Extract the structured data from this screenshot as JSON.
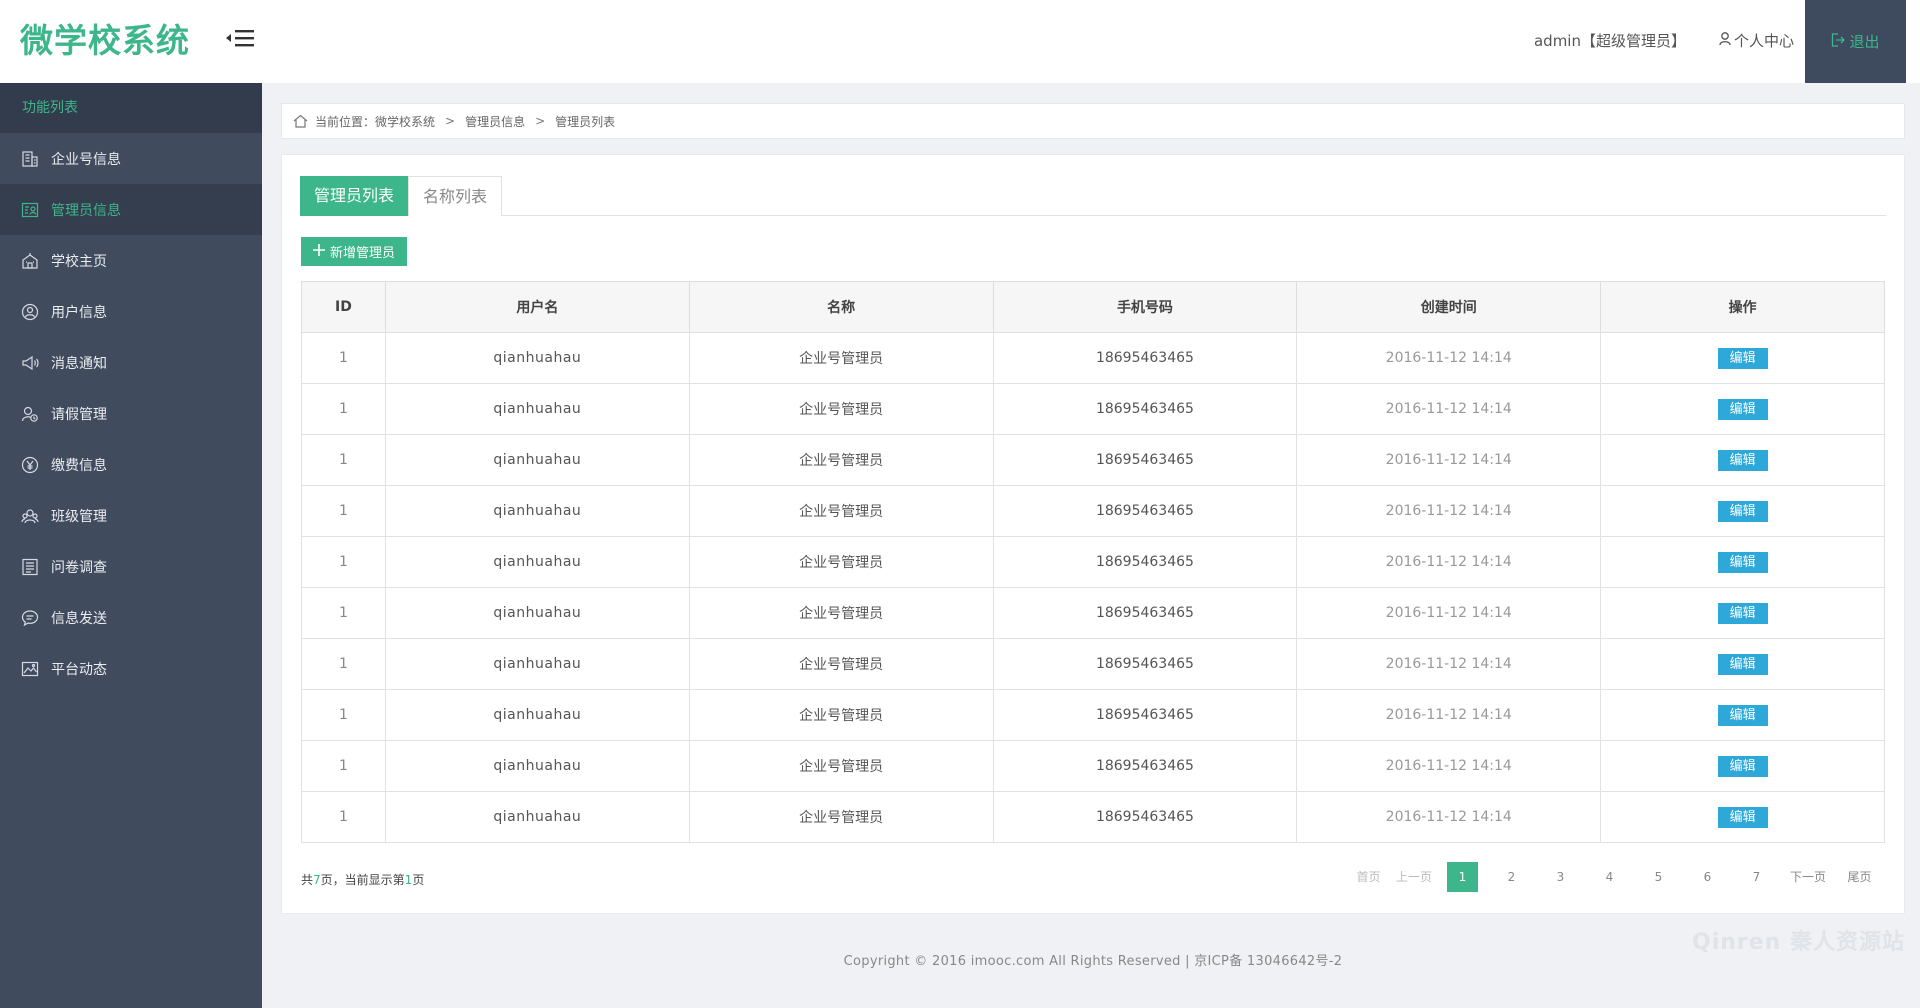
{
  "app": {
    "logo": "微学校系统"
  },
  "header": {
    "user_label": "admin【超级管理员】",
    "profile_label": "个人中心",
    "logout_label": "退出"
  },
  "sidebar": {
    "title": "功能列表",
    "items": [
      {
        "label": "企业号信息",
        "icon": "building-icon"
      },
      {
        "label": "管理员信息",
        "icon": "admin-card-icon",
        "active": true
      },
      {
        "label": "学校主页",
        "icon": "school-icon"
      },
      {
        "label": "用户信息",
        "icon": "user-circle-icon"
      },
      {
        "label": "消息通知",
        "icon": "megaphone-icon"
      },
      {
        "label": "请假管理",
        "icon": "leave-request-icon"
      },
      {
        "label": "缴费信息",
        "icon": "yen-coin-icon"
      },
      {
        "label": "班级管理",
        "icon": "class-group-icon"
      },
      {
        "label": "问卷调查",
        "icon": "survey-list-icon"
      },
      {
        "label": "信息发送",
        "icon": "chat-bubble-icon"
      },
      {
        "label": "平台动态",
        "icon": "picture-trend-icon"
      }
    ]
  },
  "breadcrumb": {
    "prefix": "当前位置：微学校系统",
    "level2": "管理员信息",
    "level3": "管理员列表",
    "separator": ">"
  },
  "tabs": [
    {
      "label": "管理员列表",
      "active": true
    },
    {
      "label": "名称列表",
      "active": false
    }
  ],
  "add_button": {
    "label": "新增管理员"
  },
  "table": {
    "headers": [
      "ID",
      "用户名",
      "名称",
      "手机号码",
      "创建时间",
      "操作"
    ],
    "rows": [
      {
        "id": "1",
        "username": "qianhuahau",
        "name": "企业号管理员",
        "phone": "18695463465",
        "created": "2016-11-12  14:14",
        "action": "编辑"
      },
      {
        "id": "1",
        "username": "qianhuahau",
        "name": "企业号管理员",
        "phone": "18695463465",
        "created": "2016-11-12  14:14",
        "action": "编辑"
      },
      {
        "id": "1",
        "username": "qianhuahau",
        "name": "企业号管理员",
        "phone": "18695463465",
        "created": "2016-11-12  14:14",
        "action": "编辑"
      },
      {
        "id": "1",
        "username": "qianhuahau",
        "name": "企业号管理员",
        "phone": "18695463465",
        "created": "2016-11-12  14:14",
        "action": "编辑"
      },
      {
        "id": "1",
        "username": "qianhuahau",
        "name": "企业号管理员",
        "phone": "18695463465",
        "created": "2016-11-12  14:14",
        "action": "编辑"
      },
      {
        "id": "1",
        "username": "qianhuahau",
        "name": "企业号管理员",
        "phone": "18695463465",
        "created": "2016-11-12  14:14",
        "action": "编辑"
      },
      {
        "id": "1",
        "username": "qianhuahau",
        "name": "企业号管理员",
        "phone": "18695463465",
        "created": "2016-11-12  14:14",
        "action": "编辑"
      },
      {
        "id": "1",
        "username": "qianhuahau",
        "name": "企业号管理员",
        "phone": "18695463465",
        "created": "2016-11-12  14:14",
        "action": "编辑"
      },
      {
        "id": "1",
        "username": "qianhuahau",
        "name": "企业号管理员",
        "phone": "18695463465",
        "created": "2016-11-12  14:14",
        "action": "编辑"
      },
      {
        "id": "1",
        "username": "qianhuahau",
        "name": "企业号管理员",
        "phone": "18695463465",
        "created": "2016-11-12  14:14",
        "action": "编辑"
      }
    ]
  },
  "pagination": {
    "info_prefix": "共",
    "total_pages": "7",
    "info_middle": "页，当前显示第",
    "current_page": "1",
    "info_suffix": "页",
    "first": "首页",
    "prev": "上一页",
    "pages": [
      "1",
      "2",
      "3",
      "4",
      "5",
      "6",
      "7"
    ],
    "next": "下一页",
    "last": "尾页"
  },
  "footer": {
    "copyright": "Copyright © 2016 imooc.com All Rights Reserved | 京ICP备 13046642号-2"
  },
  "watermark": {
    "text": "Qinren 秦人资源站"
  },
  "colors": {
    "brand_green": "#3cb68a",
    "sidebar_bg": "#414b5e",
    "sidebar_header_bg": "#333c4d",
    "edit_button_blue": "#2ea8d8",
    "logout_bg": "#3e4a5e"
  }
}
